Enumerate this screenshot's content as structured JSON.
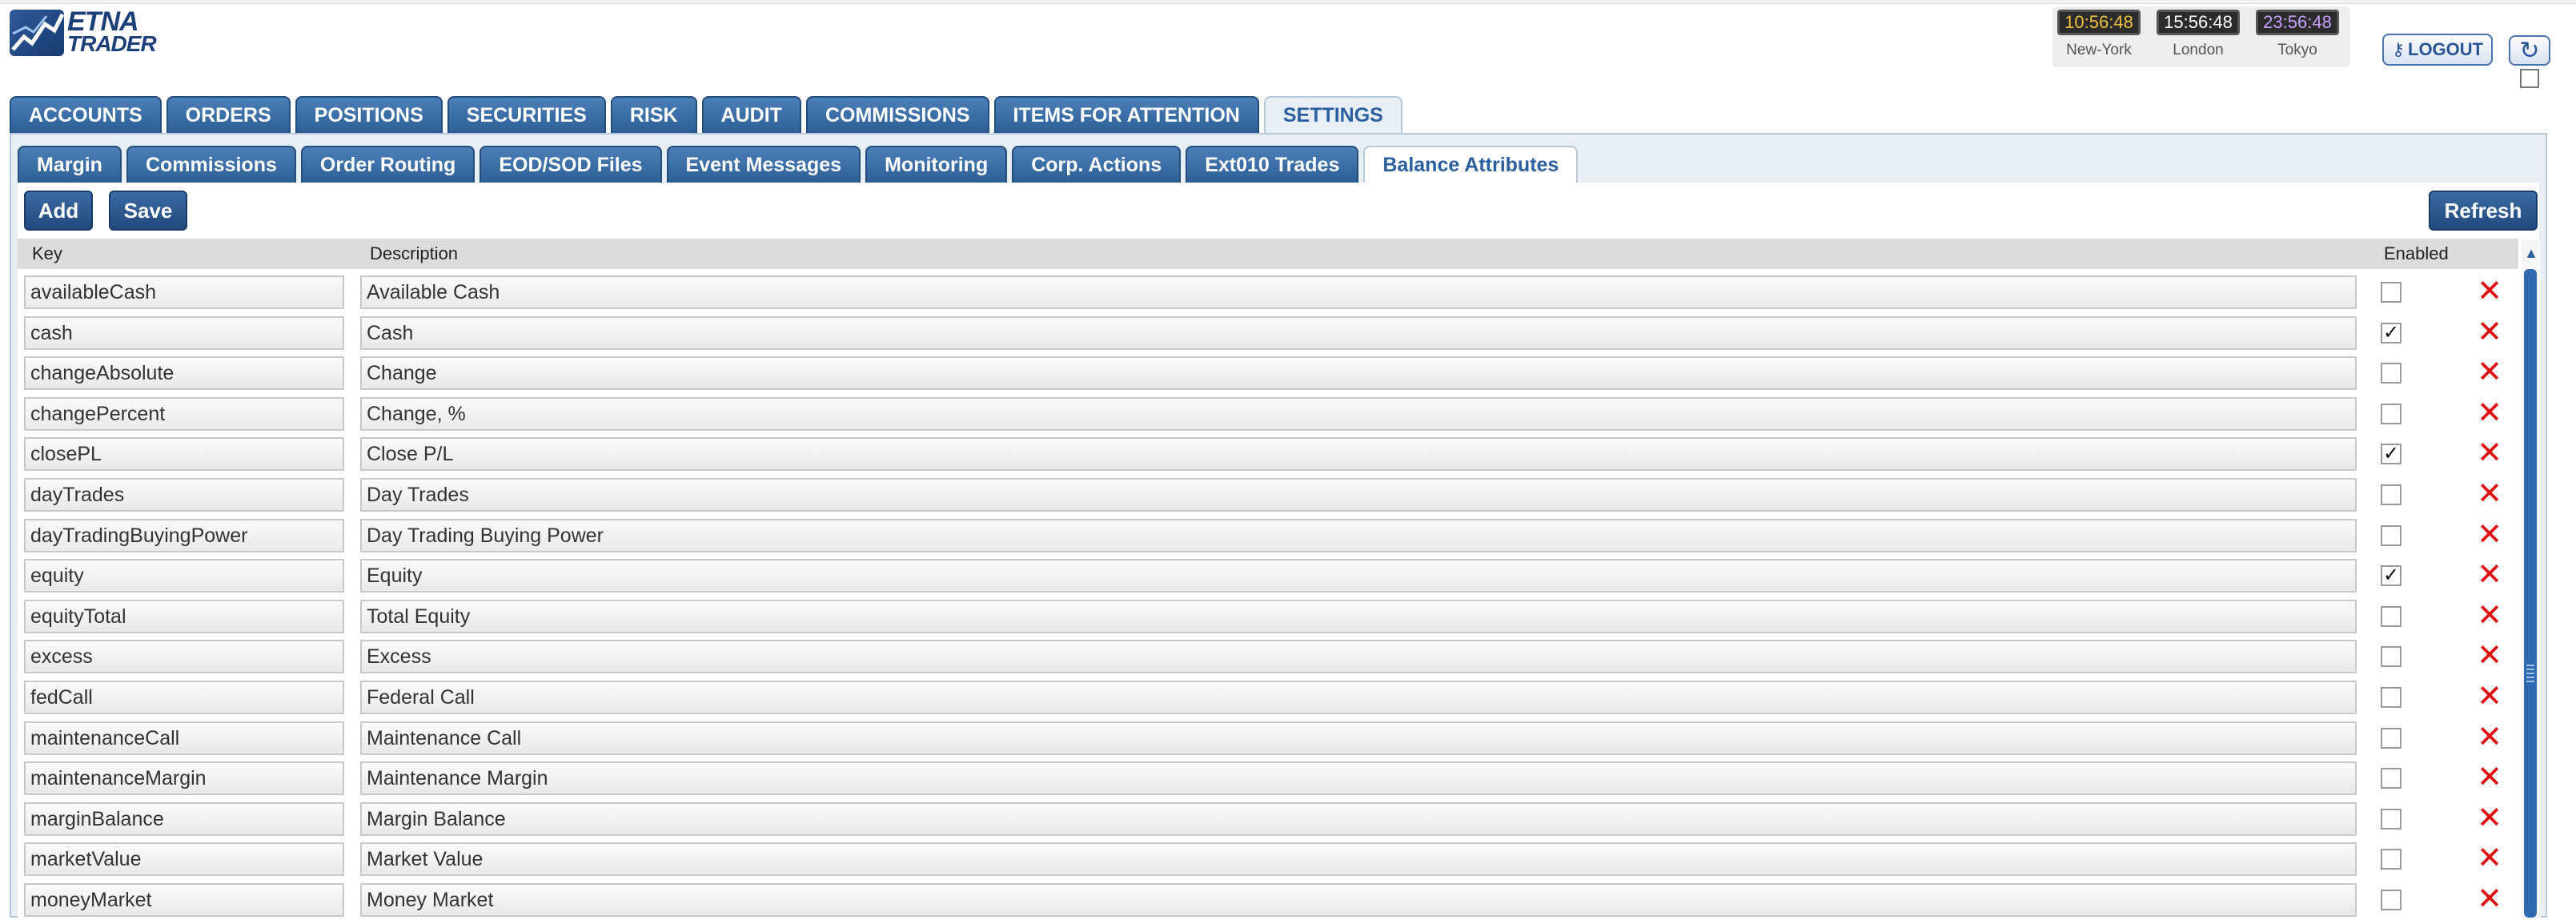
{
  "brand": {
    "line1": "ETNA",
    "line2": "TRADER"
  },
  "clocks": [
    {
      "time": "10:56:48",
      "city": "New-York",
      "color": "#f0c040"
    },
    {
      "time": "15:56:48",
      "city": "London",
      "color": "#ffffff"
    },
    {
      "time": "23:56:48",
      "city": "Tokyo",
      "color": "#c8a0ff"
    }
  ],
  "header": {
    "logout_label": "LOGOUT",
    "logout_icon": "key-icon",
    "refresh_icon": "refresh-icon"
  },
  "main_tabs": [
    "ACCOUNTS",
    "ORDERS",
    "POSITIONS",
    "SECURITIES",
    "RISK",
    "AUDIT",
    "COMMISSIONS",
    "ITEMS FOR ATTENTION",
    "SETTINGS"
  ],
  "active_main_tab": "SETTINGS",
  "sub_tabs": [
    "Margin",
    "Commissions",
    "Order Routing",
    "EOD/SOD Files",
    "Event Messages",
    "Monitoring",
    "Corp. Actions",
    "Ext010 Trades",
    "Balance Attributes"
  ],
  "active_sub_tab": "Balance Attributes",
  "toolbar": {
    "add_label": "Add",
    "save_label": "Save",
    "refresh_label": "Refresh"
  },
  "table": {
    "columns": {
      "key": "Key",
      "description": "Description",
      "enabled": "Enabled"
    },
    "rows": [
      {
        "key": "availableCash",
        "description": "Available Cash",
        "enabled": false
      },
      {
        "key": "cash",
        "description": "Cash",
        "enabled": true
      },
      {
        "key": "changeAbsolute",
        "description": "Change",
        "enabled": false
      },
      {
        "key": "changePercent",
        "description": "Change, %",
        "enabled": false
      },
      {
        "key": "closePL",
        "description": "Close P/L",
        "enabled": true
      },
      {
        "key": "dayTrades",
        "description": "Day Trades",
        "enabled": false
      },
      {
        "key": "dayTradingBuyingPower",
        "description": "Day Trading Buying Power",
        "enabled": false
      },
      {
        "key": "equity",
        "description": "Equity",
        "enabled": true
      },
      {
        "key": "equityTotal",
        "description": "Total Equity",
        "enabled": false
      },
      {
        "key": "excess",
        "description": "Excess",
        "enabled": false
      },
      {
        "key": "fedCall",
        "description": "Federal Call",
        "enabled": false
      },
      {
        "key": "maintenanceCall",
        "description": "Maintenance Call",
        "enabled": false
      },
      {
        "key": "maintenanceMargin",
        "description": "Maintenance Margin",
        "enabled": false
      },
      {
        "key": "marginBalance",
        "description": "Margin Balance",
        "enabled": false
      },
      {
        "key": "marketValue",
        "description": "Market Value",
        "enabled": false
      },
      {
        "key": "moneyMarket",
        "description": "Money Market",
        "enabled": false
      }
    ]
  },
  "colors": {
    "tab_blue": "#2d5f96",
    "accent": "#2b5fa0",
    "delete_red": "#e01010"
  }
}
